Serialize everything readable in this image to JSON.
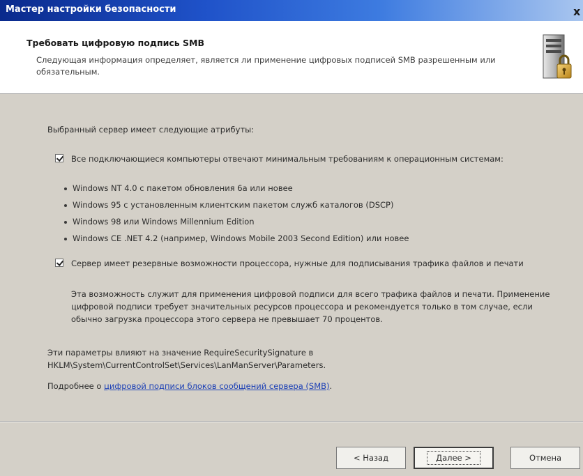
{
  "window": {
    "title": "Мастер настройки безопасности",
    "close_glyph": "x"
  },
  "header": {
    "title": "Требовать цифровую подпись SMB",
    "description": "Следующая информация определяет, является ли применение цифровых подписей SMB разрешенным или обязательным.",
    "icon": "server-lock-icon"
  },
  "content": {
    "intro": "Выбранный сервер имеет следующие атрибуты:",
    "checkboxes": [
      {
        "label": "Все подключающиеся компьютеры отвечают минимальным требованиям к операционным системам:",
        "checked": true,
        "bullets": [
          "Windows NT 4.0 с пакетом обновления 6а или новее",
          "Windows 95 с установленным клиентским пакетом служб каталогов (DSCP)",
          "Windows 98 или Windows Millennium Edition",
          "Windows CE .NET 4.2 (например, Windows Mobile 2003 Second Edition) или новее"
        ]
      },
      {
        "label": "Сервер имеет резервные возможности процессора, нужные для подписывания трафика файлов и печати",
        "checked": true,
        "description": "Эта возможность служит для применения цифровой подписи для всего трафика файлов и печати. Применение цифровой подписи требует значительных ресурсов процессора и рекомендуется только в том случае, если обычно загрузка процессора этого сервера не превышает 70 процентов."
      }
    ],
    "registry_note": "Эти параметры влияют на значение RequireSecuritySignature в HKLM\\System\\CurrentControlSet\\Services\\LanManServer\\Parameters.",
    "more_info_prefix": "Подробнее о ",
    "more_info_link": "цифровой подписи блоков сообщений сервера (SMB)",
    "more_info_suffix": "."
  },
  "footer": {
    "back_label": "< Назад",
    "next_label": "Далее >",
    "cancel_label": "Отмена"
  }
}
